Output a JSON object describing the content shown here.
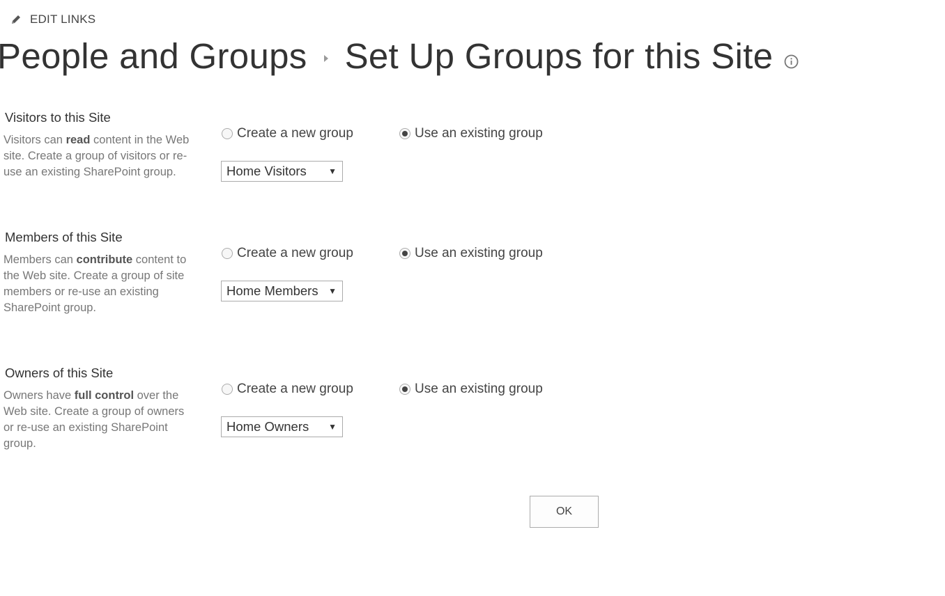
{
  "edit_links": {
    "label": "EDIT LINKS",
    "icon": "pencil-icon"
  },
  "title": {
    "part1": "People and Groups",
    "part2": "Set Up Groups for this Site",
    "info_icon": "info-icon"
  },
  "sections": [
    {
      "heading": "Visitors to this Site",
      "desc_before": "Visitors can ",
      "desc_bold": "read",
      "desc_after": " content in the Web site. Create a group of visitors or re-use an existing SharePoint group.",
      "option_new": "Create a new group",
      "option_existing": "Use an existing group",
      "selected_option": "existing",
      "dropdown_value": "Home Visitors"
    },
    {
      "heading": "Members of this Site",
      "desc_before": "Members can ",
      "desc_bold": "contribute",
      "desc_after": " content to the Web site. Create a group of site members or re-use an existing SharePoint group.",
      "option_new": "Create a new group",
      "option_existing": "Use an existing group",
      "selected_option": "existing",
      "dropdown_value": "Home Members"
    },
    {
      "heading": "Owners of this Site",
      "desc_before": "Owners have ",
      "desc_bold": "full control",
      "desc_after": " over the Web site. Create a group of owners or re-use an existing SharePoint group.",
      "option_new": "Create a new group",
      "option_existing": "Use an existing group",
      "selected_option": "existing",
      "dropdown_value": "Home Owners"
    }
  ],
  "ok_button": {
    "label": "OK"
  }
}
